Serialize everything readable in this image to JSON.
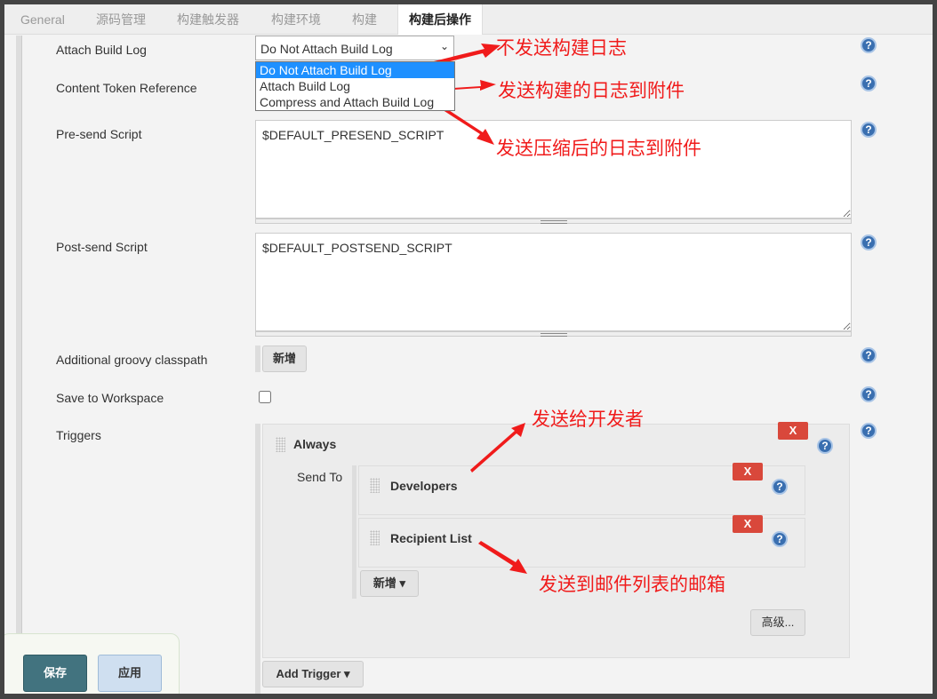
{
  "tabs": [
    "General",
    "源码管理",
    "构建触发器",
    "构建环境",
    "构建",
    "构建后操作"
  ],
  "fields": {
    "attach_build_log": "Attach Build Log",
    "content_token": "Content Token Reference",
    "pre_send": "Pre-send Script",
    "post_send": "Post-send Script",
    "groovy": "Additional groovy classpath",
    "save_ws": "Save to Workspace",
    "triggers": "Triggers"
  },
  "attach_select": {
    "value": "Do Not Attach Build Log",
    "options": [
      "Do Not Attach Build Log",
      "Attach Build Log",
      "Compress and Attach Build Log"
    ]
  },
  "pre_send_value": "$DEFAULT_PRESEND_SCRIPT",
  "post_send_value": "$DEFAULT_POSTSEND_SCRIPT",
  "add_label": "新增",
  "save_to_workspace_checked": false,
  "trigger": {
    "name": "Always",
    "send_to": "Send To",
    "recipients": [
      "Developers",
      "Recipient List"
    ],
    "remove": "X",
    "advanced": "高级...",
    "add_trigger": "Add Trigger"
  },
  "help": "?",
  "footer": {
    "save": "保存",
    "apply": "应用"
  },
  "annotations": [
    "不发送构建日志",
    "发送构建的日志到附件",
    "发送压缩后的日志到附件",
    "发送给开发者",
    "发送到邮件列表的邮箱"
  ],
  "colors": {
    "annotation": "#f01b1b",
    "remove": "#d9483b",
    "save": "#42737f",
    "selected": "#1e90ff"
  }
}
